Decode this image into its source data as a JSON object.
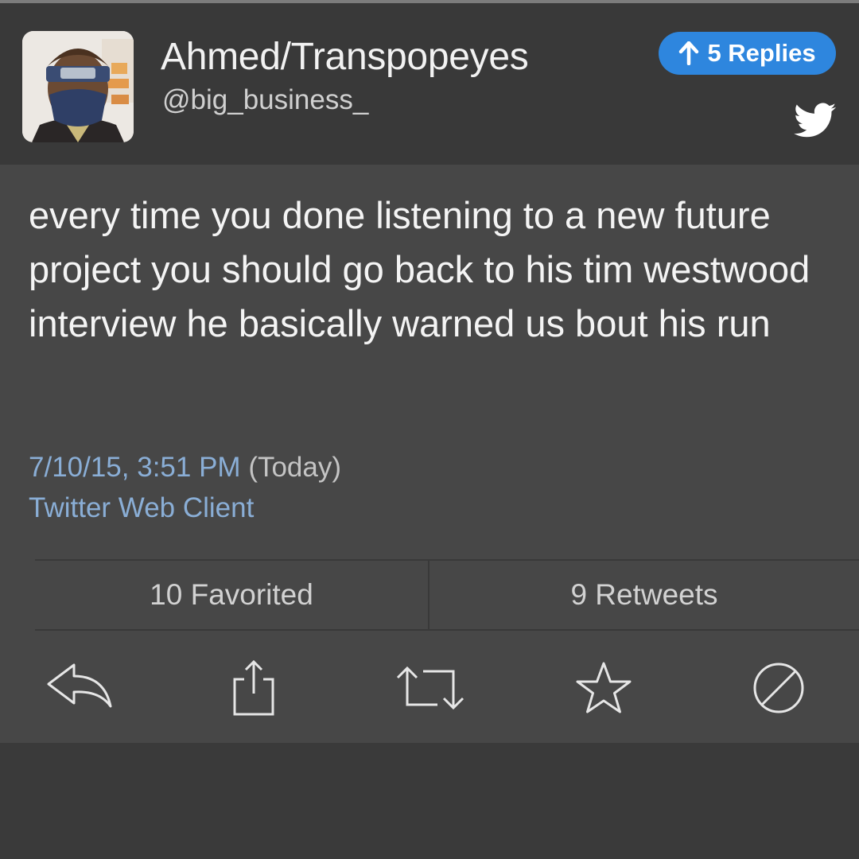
{
  "user": {
    "display_name": "Ahmed/Transpopeyes",
    "handle": "@big_business_"
  },
  "replies_button": {
    "label": "5 Replies",
    "icon": "arrow-up-icon",
    "color": "#2e86de"
  },
  "brand_icon": "twitter-bird-icon",
  "tweet": {
    "text": "every time you done listening to a new future project you should go back to his tim westwood interview he basically warned us bout his run",
    "date": "7/10/15, 3:51 PM",
    "relative": "(Today)",
    "client": "Twitter Web Client"
  },
  "stats": {
    "favorited": "10 Favorited",
    "retweets": "9 Retweets"
  },
  "actions": [
    {
      "name": "reply",
      "icon": "reply-icon"
    },
    {
      "name": "share",
      "icon": "share-icon"
    },
    {
      "name": "retweet",
      "icon": "retweet-icon"
    },
    {
      "name": "favorite",
      "icon": "star-icon"
    },
    {
      "name": "block",
      "icon": "block-icon"
    }
  ],
  "colors": {
    "link": "#8aaed6",
    "header_bg": "#393939",
    "tweet_bg": "#474747"
  }
}
